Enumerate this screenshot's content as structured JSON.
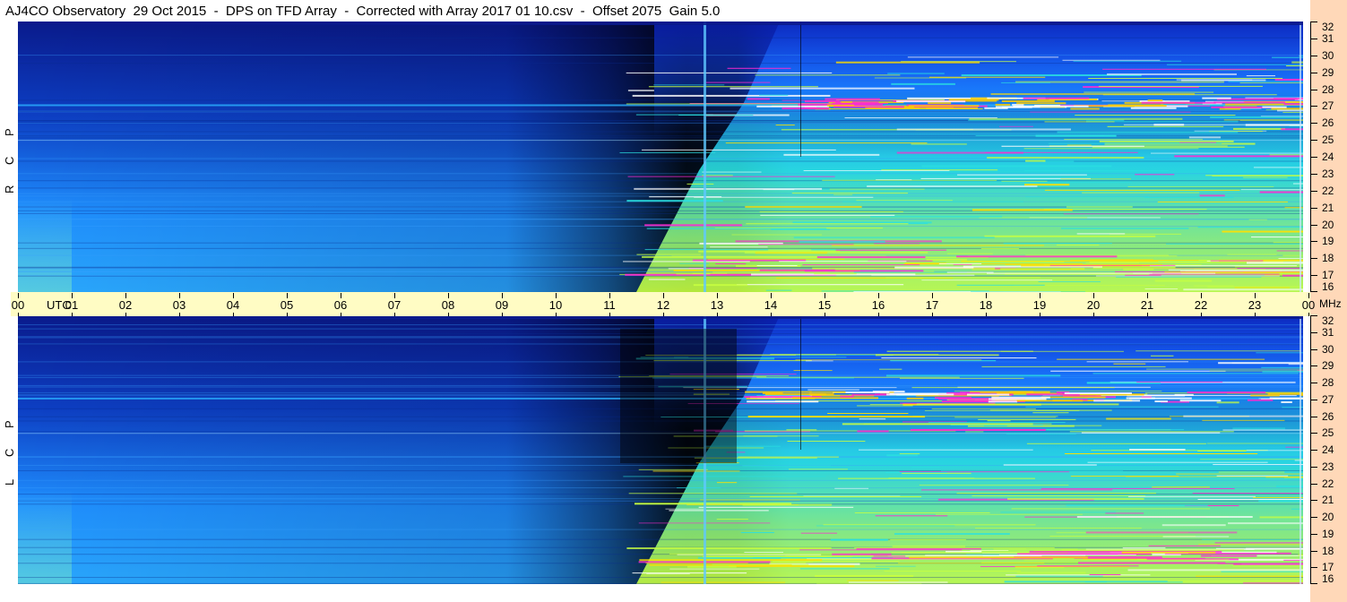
{
  "title": "AJ4CO Observatory  29 Oct 2015  -  DPS on TFD Array  -  Corrected with Array 2017 01 10.csv  -  Offset 2075  Gain 5.0",
  "chart_data": [
    {
      "type": "heatmap",
      "panel": "RCP",
      "polarization_label": [
        "R",
        "C",
        "P"
      ],
      "x_unit": "UTC",
      "x_ticks": [
        "00",
        "01",
        "02",
        "03",
        "04",
        "05",
        "06",
        "07",
        "08",
        "09",
        "10",
        "11",
        "12",
        "13",
        "14",
        "15",
        "16",
        "17",
        "18",
        "19",
        "20",
        "21",
        "22",
        "23",
        "00"
      ],
      "y_unit": "MHz",
      "y_ticks": [
        16,
        17,
        18,
        19,
        20,
        21,
        22,
        23,
        24,
        25,
        26,
        27,
        28,
        29,
        30,
        31,
        32
      ],
      "ylim": [
        16,
        32
      ]
    },
    {
      "type": "heatmap",
      "panel": "LCP",
      "polarization_label": [
        "L",
        "C",
        "P"
      ],
      "x_unit": "UTC",
      "x_ticks": [
        "00",
        "01",
        "02",
        "03",
        "04",
        "05",
        "06",
        "07",
        "08",
        "09",
        "10",
        "11",
        "12",
        "13",
        "14",
        "15",
        "16",
        "17",
        "18",
        "19",
        "20",
        "21",
        "22",
        "23",
        "00"
      ],
      "y_unit": "MHz",
      "y_ticks": [
        16,
        17,
        18,
        19,
        20,
        21,
        22,
        23,
        24,
        25,
        26,
        27,
        28,
        29,
        30,
        31,
        32
      ],
      "ylim": [
        16,
        32
      ]
    }
  ],
  "time_axis": {
    "utc_label": "UTC",
    "mhz_label": "MHz"
  },
  "colors": {
    "background_dark": "#000000",
    "low_blue": "#0a1a8c",
    "mid_blue": "#1f8fff",
    "cyan": "#2ae0e0",
    "green_yellow": "#c8ff40",
    "magenta": "#ff2ad0",
    "white": "#ffffff",
    "time_strip": "#fffcc4",
    "right_strip": "#ffd8b8"
  }
}
